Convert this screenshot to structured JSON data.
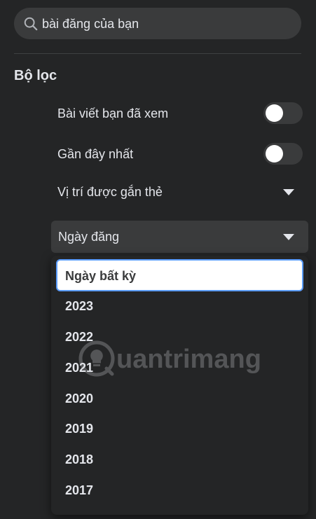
{
  "search": {
    "value": "bài đăng của bạn",
    "icon": "search-icon"
  },
  "filters": {
    "title": "Bộ lọc",
    "seen_posts": {
      "label": "Bài viết bạn đã xem",
      "enabled": false
    },
    "most_recent": {
      "label": "Gần đây nhất",
      "enabled": false
    },
    "tagged_location": {
      "label": "Vị trí được gắn thẻ"
    },
    "date_posted": {
      "label": "Ngày đăng",
      "options": [
        "Ngày bất kỳ",
        "2023",
        "2022",
        "2021",
        "2020",
        "2019",
        "2018",
        "2017"
      ],
      "selected": "Ngày bất kỳ"
    }
  },
  "watermark": {
    "text": "uantrimang"
  },
  "colors": {
    "background": "#242526",
    "control": "#3a3b3c",
    "text": "#e4e6eb",
    "focus_ring": "#5b9dff"
  }
}
